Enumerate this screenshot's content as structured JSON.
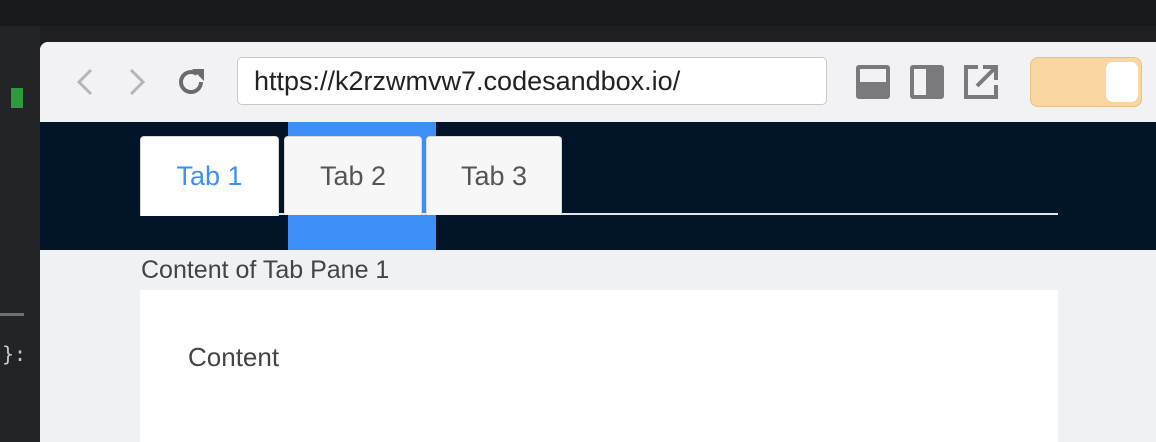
{
  "browser": {
    "url": "https://k2rzwmvw7.codesandbox.io/",
    "toggle_accent": "#fad7a2"
  },
  "tabs": [
    {
      "label": "Tab 1",
      "active": true
    },
    {
      "label": "Tab 2",
      "active": false
    },
    {
      "label": "Tab 3",
      "active": false
    }
  ],
  "content": {
    "pane_title": "Content of Tab Pane 1",
    "card_text": "Content"
  },
  "editor": {
    "brace": "}:"
  },
  "colors": {
    "header_bg": "#021428",
    "active_tab": "#3b8ff6",
    "highlight": "#3b8ff6"
  }
}
